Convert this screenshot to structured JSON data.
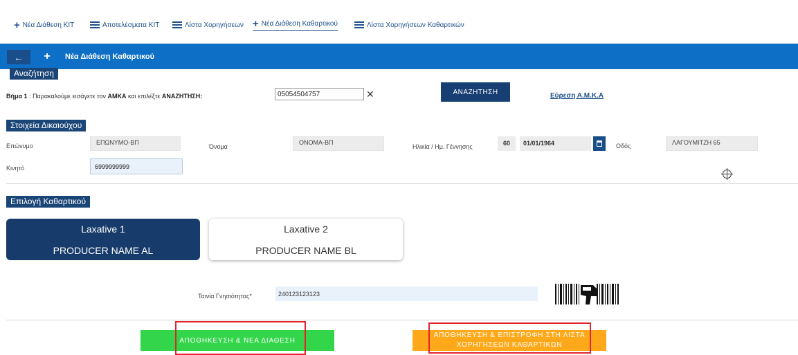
{
  "nav": {
    "items": [
      {
        "label": "Νέα Διάθεση ΚΙΤ",
        "icon": "plus-icon"
      },
      {
        "label": "Αποτελέσματα ΚΙΤ",
        "icon": "list-icon"
      },
      {
        "label": "Λίστα Χορηγήσεων",
        "icon": "list-icon"
      },
      {
        "label": "Νέα Διάθεση Καθαρτικού",
        "icon": "plus-icon",
        "active": true
      },
      {
        "label": "Λίστα Χορηγήσεων Καθαρτικών",
        "icon": "list-icon"
      }
    ]
  },
  "header": {
    "back_symbol": "←",
    "plus_symbol": "+",
    "title": "Νέα Διάθεση Καθαρτικού",
    "color": "#0d6fc6"
  },
  "search": {
    "section_label": "Αναζήτηση",
    "step_prefix": "Βήμα 1",
    "step_colon": " : ",
    "step_text": "Παρακαλούμε εισάγετε τον ",
    "step_amka": "ΑΜΚΑ",
    "step_and": " και επιλέξτε ",
    "step_search": "ΑΝΑΖΗΤΗΣΗ:",
    "amka_value": "05054504757",
    "clear_symbol": "✕",
    "search_button": "ΑΝΑΖΗΤΗΣΗ",
    "find_amka_link": "Εύρεση Α.Μ.Κ.Α"
  },
  "beneficiary": {
    "section_label": "Στοιχεία Δικαιούχου",
    "surname_label": "Επώνυμο",
    "surname_value": "ΕΠΩΝΥΜΟ-ΒΠ",
    "name_label": "Όνομα",
    "name_value": "ΟΝΟΜΑ-ΒΠ",
    "age_dob_label": "Ηλικία / Ημ. Γέννησης",
    "age_value": "60",
    "dob_value": "01/01/1964",
    "street_label": "Οδός",
    "street_value": "ΛΑΓΟΥΜΙΤΖΗ 65",
    "mobile_label": "Κινητό",
    "mobile_value": "6999999999"
  },
  "laxative": {
    "section_label": "Επιλογή Καθαρτικού",
    "options": [
      {
        "name": "Laxative 1",
        "producer": "PRODUCER NAME AL",
        "selected": true
      },
      {
        "name": "Laxative 2",
        "producer": "PRODUCER NAME BL",
        "selected": false
      }
    ],
    "auth_label": "Ταινία Γνησιότητας*",
    "auth_value": "240123123123"
  },
  "actions": {
    "save_new_button": "ΑΠΟΘΗΚΕΥΣΗ & ΝΕΑ ΔΙΑΘΕΣΗ",
    "save_return_button": "ΑΠΟΘΗΚΕΥΣΗ & ΕΠΙΣΤΡΟΦΗ ΣΤΗ ΛΙΣΤΑ ΧΟΡΗΓΗΣΕΩΝ ΚΑΘΑΡΤΙΚΩΝ",
    "save_new_color": "#33d54a",
    "save_return_color": "#ffa91a",
    "highlight_color": "#e0242a"
  }
}
